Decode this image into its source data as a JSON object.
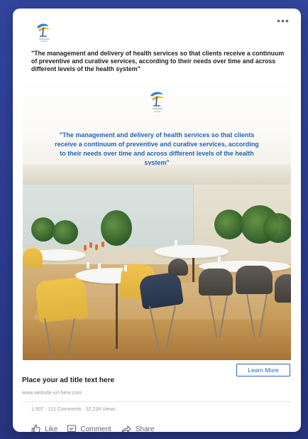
{
  "post": {
    "text": "\"The management and delivery of health services so that clients receive a continuum of preventive and curative services, according to their needs over time and across different levels of the health system\"",
    "more_icon": "more-horizontal-icon"
  },
  "hero": {
    "quote": "\"The management and delivery of health services so that clients receive a continuum of preventive and curative services, according to their needs over time and across different levels of the health system\""
  },
  "ad": {
    "title": "Place your ad title text here",
    "url": "www.website-url-here.com",
    "button_label": "Learn More"
  },
  "engagement": {
    "stats": "1,607 · 112 Comments · 32,234 Views",
    "like_label": "Like",
    "comment_label": "Comment",
    "share_label": "Share"
  },
  "colors": {
    "background": "#2f3f96",
    "card": "#ffffff",
    "accent_blue": "#2a65b4"
  }
}
